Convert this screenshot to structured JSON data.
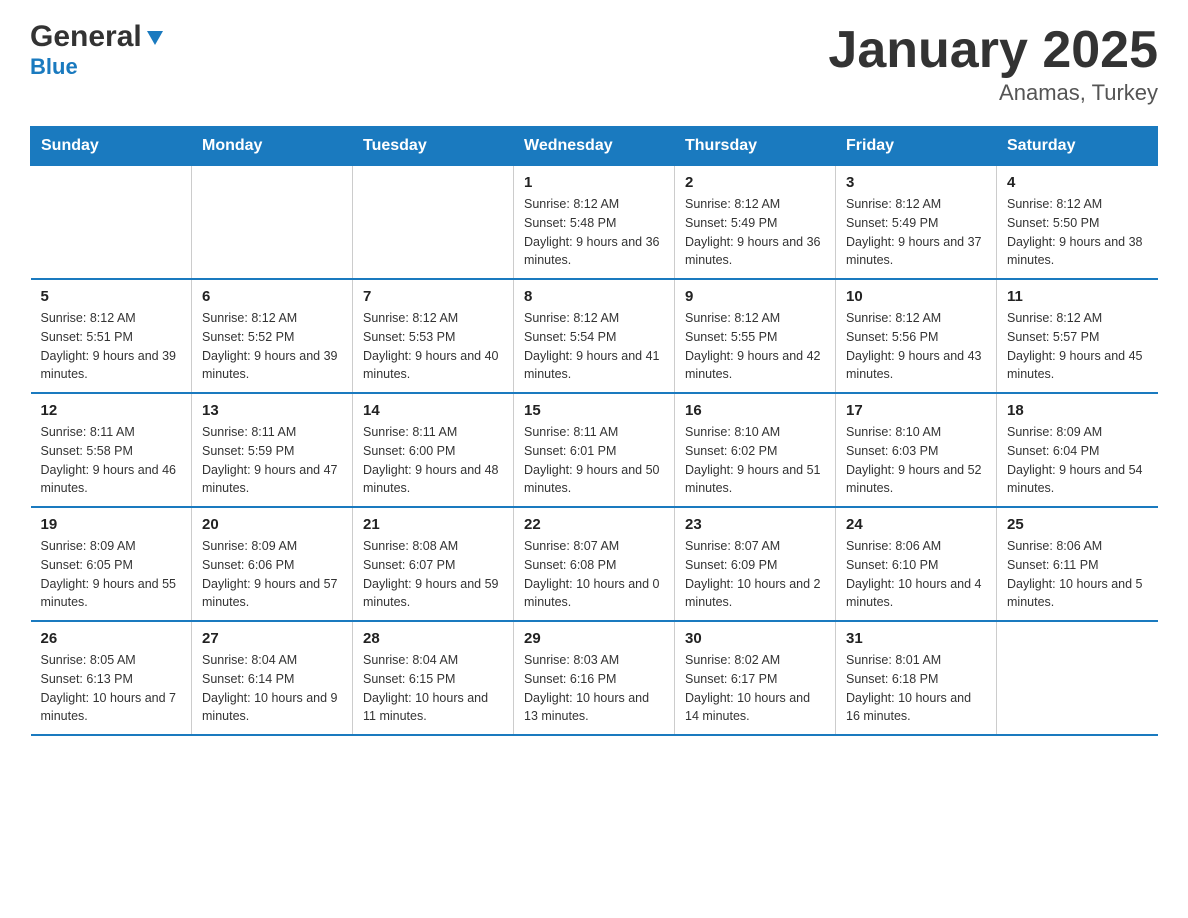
{
  "logo": {
    "general": "General",
    "blue": "Blue"
  },
  "header": {
    "title": "January 2025",
    "subtitle": "Anamas, Turkey"
  },
  "weekdays": [
    "Sunday",
    "Monday",
    "Tuesday",
    "Wednesday",
    "Thursday",
    "Friday",
    "Saturday"
  ],
  "weeks": [
    [
      {
        "day": "",
        "info": ""
      },
      {
        "day": "",
        "info": ""
      },
      {
        "day": "",
        "info": ""
      },
      {
        "day": "1",
        "info": "Sunrise: 8:12 AM\nSunset: 5:48 PM\nDaylight: 9 hours and 36 minutes."
      },
      {
        "day": "2",
        "info": "Sunrise: 8:12 AM\nSunset: 5:49 PM\nDaylight: 9 hours and 36 minutes."
      },
      {
        "day": "3",
        "info": "Sunrise: 8:12 AM\nSunset: 5:49 PM\nDaylight: 9 hours and 37 minutes."
      },
      {
        "day": "4",
        "info": "Sunrise: 8:12 AM\nSunset: 5:50 PM\nDaylight: 9 hours and 38 minutes."
      }
    ],
    [
      {
        "day": "5",
        "info": "Sunrise: 8:12 AM\nSunset: 5:51 PM\nDaylight: 9 hours and 39 minutes."
      },
      {
        "day": "6",
        "info": "Sunrise: 8:12 AM\nSunset: 5:52 PM\nDaylight: 9 hours and 39 minutes."
      },
      {
        "day": "7",
        "info": "Sunrise: 8:12 AM\nSunset: 5:53 PM\nDaylight: 9 hours and 40 minutes."
      },
      {
        "day": "8",
        "info": "Sunrise: 8:12 AM\nSunset: 5:54 PM\nDaylight: 9 hours and 41 minutes."
      },
      {
        "day": "9",
        "info": "Sunrise: 8:12 AM\nSunset: 5:55 PM\nDaylight: 9 hours and 42 minutes."
      },
      {
        "day": "10",
        "info": "Sunrise: 8:12 AM\nSunset: 5:56 PM\nDaylight: 9 hours and 43 minutes."
      },
      {
        "day": "11",
        "info": "Sunrise: 8:12 AM\nSunset: 5:57 PM\nDaylight: 9 hours and 45 minutes."
      }
    ],
    [
      {
        "day": "12",
        "info": "Sunrise: 8:11 AM\nSunset: 5:58 PM\nDaylight: 9 hours and 46 minutes."
      },
      {
        "day": "13",
        "info": "Sunrise: 8:11 AM\nSunset: 5:59 PM\nDaylight: 9 hours and 47 minutes."
      },
      {
        "day": "14",
        "info": "Sunrise: 8:11 AM\nSunset: 6:00 PM\nDaylight: 9 hours and 48 minutes."
      },
      {
        "day": "15",
        "info": "Sunrise: 8:11 AM\nSunset: 6:01 PM\nDaylight: 9 hours and 50 minutes."
      },
      {
        "day": "16",
        "info": "Sunrise: 8:10 AM\nSunset: 6:02 PM\nDaylight: 9 hours and 51 minutes."
      },
      {
        "day": "17",
        "info": "Sunrise: 8:10 AM\nSunset: 6:03 PM\nDaylight: 9 hours and 52 minutes."
      },
      {
        "day": "18",
        "info": "Sunrise: 8:09 AM\nSunset: 6:04 PM\nDaylight: 9 hours and 54 minutes."
      }
    ],
    [
      {
        "day": "19",
        "info": "Sunrise: 8:09 AM\nSunset: 6:05 PM\nDaylight: 9 hours and 55 minutes."
      },
      {
        "day": "20",
        "info": "Sunrise: 8:09 AM\nSunset: 6:06 PM\nDaylight: 9 hours and 57 minutes."
      },
      {
        "day": "21",
        "info": "Sunrise: 8:08 AM\nSunset: 6:07 PM\nDaylight: 9 hours and 59 minutes."
      },
      {
        "day": "22",
        "info": "Sunrise: 8:07 AM\nSunset: 6:08 PM\nDaylight: 10 hours and 0 minutes."
      },
      {
        "day": "23",
        "info": "Sunrise: 8:07 AM\nSunset: 6:09 PM\nDaylight: 10 hours and 2 minutes."
      },
      {
        "day": "24",
        "info": "Sunrise: 8:06 AM\nSunset: 6:10 PM\nDaylight: 10 hours and 4 minutes."
      },
      {
        "day": "25",
        "info": "Sunrise: 8:06 AM\nSunset: 6:11 PM\nDaylight: 10 hours and 5 minutes."
      }
    ],
    [
      {
        "day": "26",
        "info": "Sunrise: 8:05 AM\nSunset: 6:13 PM\nDaylight: 10 hours and 7 minutes."
      },
      {
        "day": "27",
        "info": "Sunrise: 8:04 AM\nSunset: 6:14 PM\nDaylight: 10 hours and 9 minutes."
      },
      {
        "day": "28",
        "info": "Sunrise: 8:04 AM\nSunset: 6:15 PM\nDaylight: 10 hours and 11 minutes."
      },
      {
        "day": "29",
        "info": "Sunrise: 8:03 AM\nSunset: 6:16 PM\nDaylight: 10 hours and 13 minutes."
      },
      {
        "day": "30",
        "info": "Sunrise: 8:02 AM\nSunset: 6:17 PM\nDaylight: 10 hours and 14 minutes."
      },
      {
        "day": "31",
        "info": "Sunrise: 8:01 AM\nSunset: 6:18 PM\nDaylight: 10 hours and 16 minutes."
      },
      {
        "day": "",
        "info": ""
      }
    ]
  ]
}
